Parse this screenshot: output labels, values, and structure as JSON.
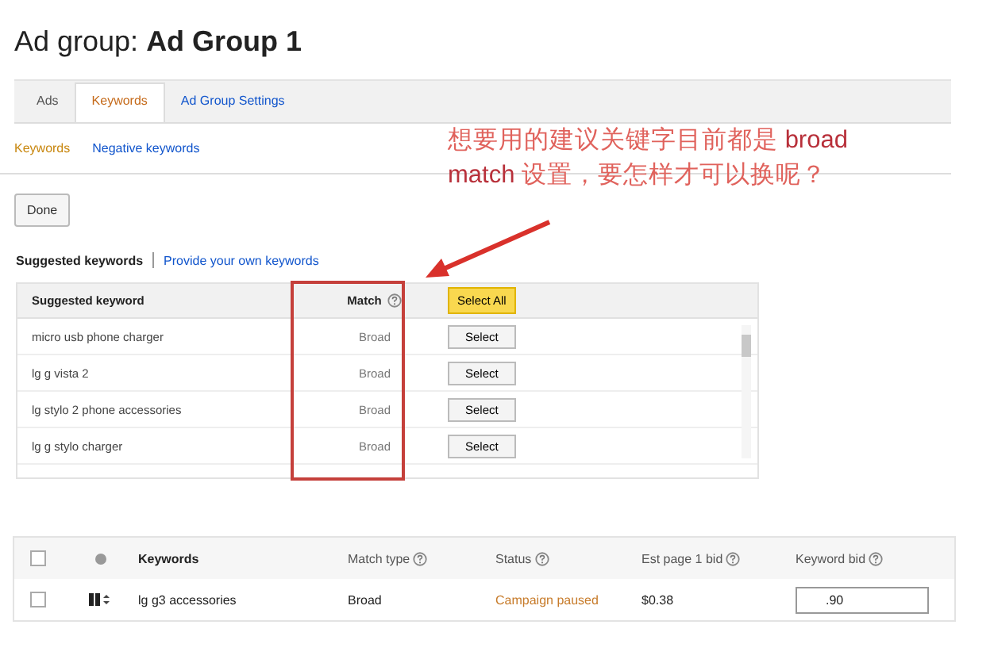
{
  "title": {
    "prefix": "Ad group:",
    "name": "Ad Group 1"
  },
  "tabs": [
    {
      "label": "Ads",
      "selected": false
    },
    {
      "label": "Keywords",
      "selected": true
    },
    {
      "label": "Ad Group Settings",
      "selected": false
    }
  ],
  "subtabs": [
    {
      "label": "Keywords",
      "selected": true
    },
    {
      "label": "Negative keywords",
      "selected": false
    }
  ],
  "annotation": "想要用的建议关键字目前都是 **broad** **match** 设置，要怎样才可以换呢？",
  "done_button": "Done",
  "suggest_tabs": [
    {
      "label": "Suggested keywords",
      "selected": true
    },
    {
      "label": "Provide your own keywords",
      "selected": false
    }
  ],
  "suggestions": {
    "columns": [
      "Suggested keyword",
      "Match",
      "Select All"
    ],
    "rows": [
      {
        "keyword": "micro usb phone charger",
        "match": "Broad",
        "action": "Select"
      },
      {
        "keyword": "lg g vista 2",
        "match": "Broad",
        "action": "Select"
      },
      {
        "keyword": "lg stylo 2 phone accessories",
        "match": "Broad",
        "action": "Select"
      },
      {
        "keyword": "lg g stylo charger",
        "match": "Broad",
        "action": "Select"
      }
    ]
  },
  "keywords_table": {
    "header_checked": false,
    "columns": [
      "Keywords",
      "Match type",
      "Status",
      "Est page 1 bid",
      "Keyword bid"
    ],
    "rows": [
      {
        "checked": false,
        "keyword": "lg g3 accessories",
        "match": "Broad",
        "status": "Campaign paused",
        "est_bid": "$0.38",
        "bid": ".90"
      }
    ]
  }
}
